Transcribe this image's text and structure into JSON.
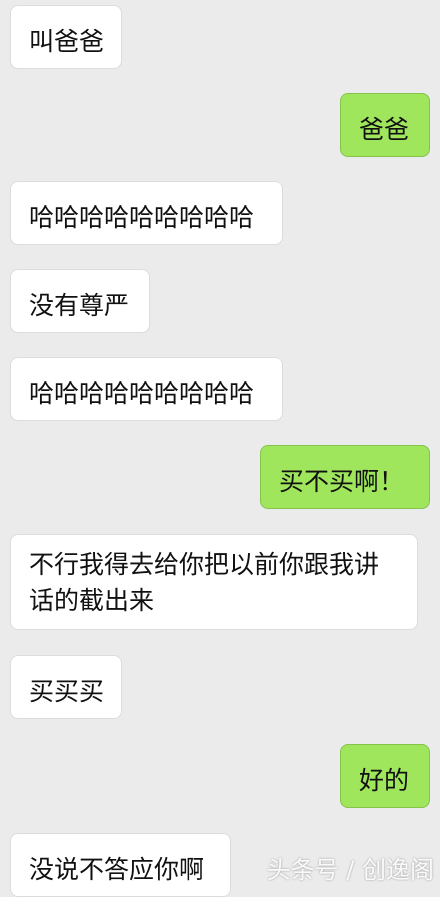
{
  "messages": [
    {
      "side": "left",
      "text": "叫爸爸"
    },
    {
      "side": "right",
      "text": "爸爸"
    },
    {
      "side": "left",
      "text": "哈哈哈哈哈哈哈哈哈"
    },
    {
      "side": "left",
      "text": "没有尊严"
    },
    {
      "side": "left",
      "text": "哈哈哈哈哈哈哈哈哈"
    },
    {
      "side": "right",
      "text": "买不买啊！"
    },
    {
      "side": "left",
      "text": "不行我得去给你把以前你跟我讲话的截出来"
    },
    {
      "side": "left",
      "text": "买买买"
    },
    {
      "side": "right",
      "text": "好的"
    },
    {
      "side": "left",
      "text": "没说不答应你啊"
    }
  ],
  "watermark": "头条号 / 创逸阁"
}
